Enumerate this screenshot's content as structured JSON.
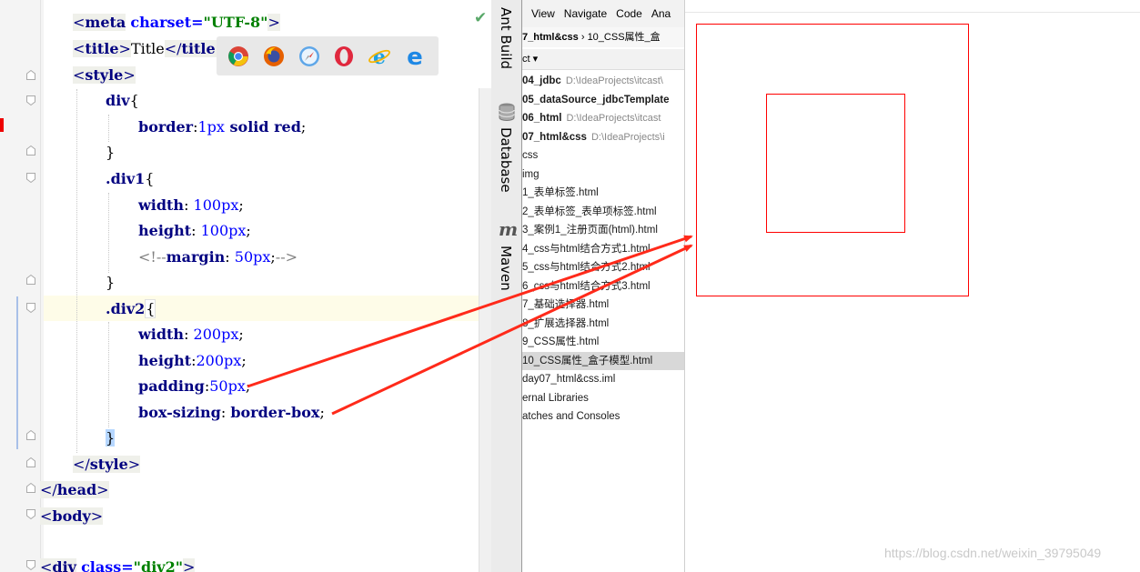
{
  "editor": {
    "lines": {
      "l1": {
        "open": "<",
        "tag": "meta",
        "sp": " ",
        "attr": "charset",
        "eq": "=",
        "val": "\"UTF-8\"",
        "close": ">"
      },
      "l2": {
        "o1": "<",
        "t1": "title",
        "c1": ">",
        "text": "Title",
        "o2": "</",
        "t2": "title",
        "c2": ">"
      },
      "l3": {
        "o": "<",
        "t": "style",
        "c": ">"
      },
      "l4": {
        "sel": "div",
        "br": "{"
      },
      "l5": {
        "prop": "border",
        "colon": ":",
        "n": "1px",
        "rest": " solid red",
        "semi": ";"
      },
      "l6": {
        "br": "}"
      },
      "l7": {
        "sel": ".div1",
        "br": "{"
      },
      "l8": {
        "prop": "width",
        "colon": ": ",
        "n": "100px",
        "semi": ";"
      },
      "l9": {
        "prop": "height",
        "colon": ": ",
        "n": "100px",
        "semi": ";"
      },
      "l10": {
        "o": "<!--",
        "prop": "margin",
        "colon": ": ",
        "n": "50px",
        "semi": ";",
        "c": "-->"
      },
      "l11": {
        "br": "}"
      },
      "l12": {
        "sel": ".div2",
        "br": "{"
      },
      "l13": {
        "prop": "width",
        "colon": ": ",
        "n": "200px",
        "semi": ";"
      },
      "l14": {
        "prop": "height",
        "colon": ":",
        "n": "200px",
        "semi": ";"
      },
      "l15": {
        "prop": "padding",
        "colon": ":",
        "n": "50px",
        "semi": ";"
      },
      "l16": {
        "prop": "box-sizing",
        "colon": ": ",
        "v": "border-box",
        "semi": ";"
      },
      "l17": {
        "br": "}"
      },
      "l18": {
        "o": "</",
        "t": "style",
        "c": ">"
      },
      "l19": {
        "o": "</",
        "t": "head",
        "c": ">"
      },
      "l20": {
        "o": "<",
        "t": "body",
        "c": ">"
      },
      "l21": {
        "o": "<",
        "t": "div",
        "sp": " ",
        "attr": "class",
        "eq": "=",
        "val": "\"div2\"",
        "c": ">"
      }
    },
    "status_icon": "checkmark-icon",
    "status_glyph": "✔",
    "status_color": "#59a869"
  },
  "browser_popup": {
    "icons": [
      "chrome-icon",
      "firefox-icon",
      "safari-icon",
      "opera-icon",
      "ie-icon",
      "edge-icon"
    ]
  },
  "sidebar": {
    "tabs": [
      {
        "label": "Ant Build",
        "icon": "ant-icon"
      },
      {
        "label": "Database",
        "icon": "database-icon"
      },
      {
        "label": "Maven",
        "icon": "maven-icon",
        "glyph": "m"
      }
    ]
  },
  "project": {
    "menu": [
      "View",
      "Navigate",
      "Code",
      "Ana"
    ],
    "breadcrumb": {
      "first": "7_html&css",
      "sep": "›",
      "second": "10_CSS属性_盒"
    },
    "header": "ct ▾",
    "items": [
      {
        "name": "04_jdbc",
        "path": "D:\\IdeaProjects\\itcast\\",
        "bold": true
      },
      {
        "name": "05_dataSource_jdbcTemplate",
        "path": "",
        "bold": true
      },
      {
        "name": "06_html",
        "path": "D:\\IdeaProjects\\itcast",
        "bold": true
      },
      {
        "name": "07_html&css",
        "path": "D:\\IdeaProjects\\i",
        "bold": true
      },
      {
        "name": "css",
        "path": "",
        "bold": false
      },
      {
        "name": "img",
        "path": "",
        "bold": false
      },
      {
        "name": "1_表单标签.html",
        "path": "",
        "bold": false
      },
      {
        "name": "2_表单标签_表单项标签.html",
        "path": "",
        "bold": false
      },
      {
        "name": "3_案例1_注册页面(html).html",
        "path": "",
        "bold": false
      },
      {
        "name": "4_css与html结合方式1.html",
        "path": "",
        "bold": false
      },
      {
        "name": "5_css与html结合方式2.html",
        "path": "",
        "bold": false
      },
      {
        "name": "6_css与html结合方式3.html",
        "path": "",
        "bold": false
      },
      {
        "name": "7_基础选择器.html",
        "path": "",
        "bold": false
      },
      {
        "name": "8_扩展选择器.html",
        "path": "",
        "bold": false
      },
      {
        "name": "9_CSS属性.html",
        "path": "",
        "bold": false
      },
      {
        "name": "10_CSS属性_盒子模型.html",
        "path": "",
        "bold": false,
        "selected": true
      },
      {
        "name": "day07_html&css.iml",
        "path": "",
        "bold": false
      },
      {
        "name": "ernal Libraries",
        "path": "",
        "bold": false
      },
      {
        "name": "atches and Consoles",
        "path": "",
        "bold": false
      }
    ]
  },
  "preview": {
    "watermark": "https://blog.csdn.net/weixin_39795049",
    "box_color": "#ff0000",
    "arrow_color": "#ff2a1a"
  }
}
